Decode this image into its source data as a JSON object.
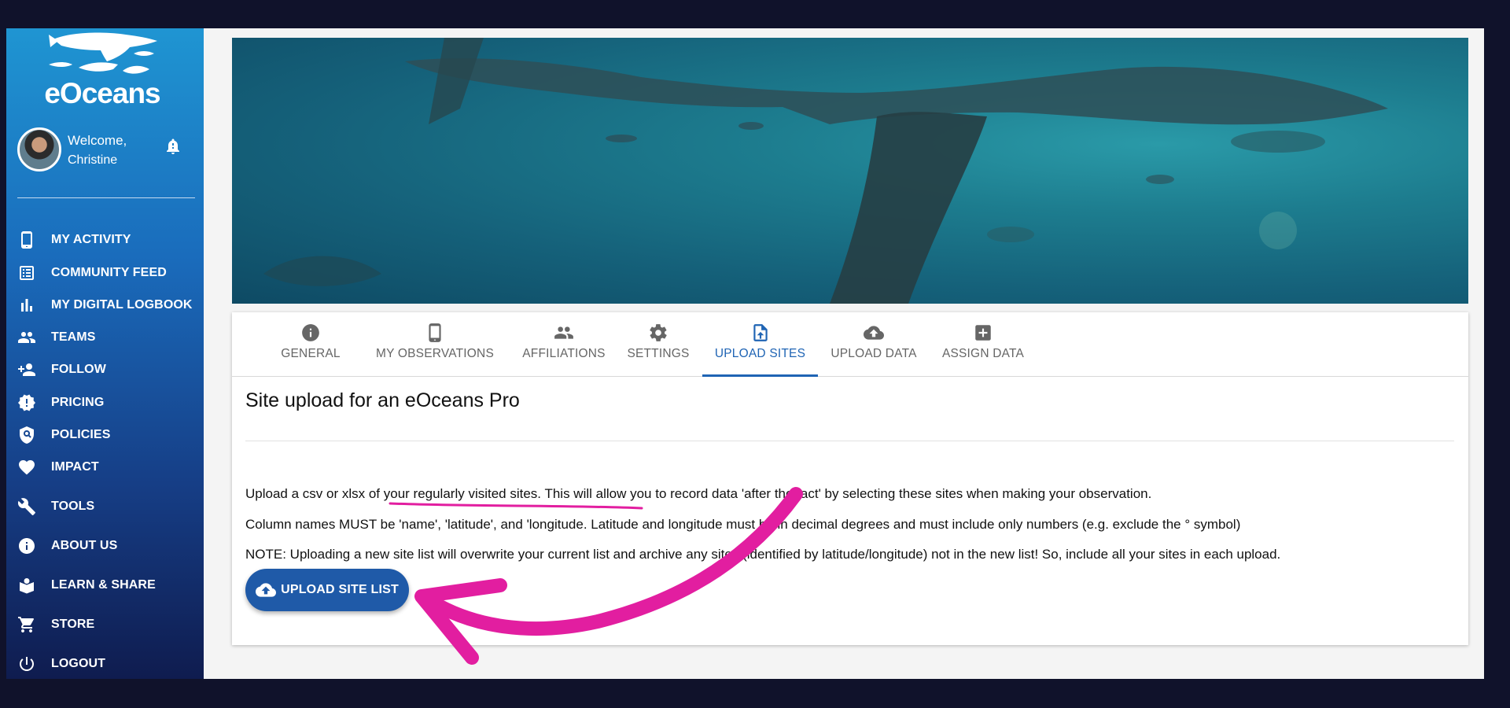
{
  "brand": {
    "name": "eOceans"
  },
  "user": {
    "welcome": "Welcome,",
    "name": "Christine"
  },
  "nav": [
    {
      "label": "MY ACTIVITY",
      "icon": "phone-icon"
    },
    {
      "label": "COMMUNITY FEED",
      "icon": "feed-icon"
    },
    {
      "label": "MY DIGITAL LOGBOOK",
      "icon": "bar-chart-icon"
    },
    {
      "label": "TEAMS",
      "icon": "people-icon"
    },
    {
      "label": "FOLLOW",
      "icon": "add-person-icon"
    },
    {
      "label": "PRICING",
      "icon": "badge-icon"
    },
    {
      "label": "POLICIES",
      "icon": "shield-icon"
    },
    {
      "label": "IMPACT",
      "icon": "heart-icon"
    },
    {
      "label": "TOOLS",
      "icon": "wrench-icon"
    },
    {
      "label": "ABOUT US",
      "icon": "info-icon"
    },
    {
      "label": "LEARN & SHARE",
      "icon": "book-icon"
    },
    {
      "label": "STORE",
      "icon": "cart-icon"
    },
    {
      "label": "LOGOUT",
      "icon": "power-icon"
    }
  ],
  "tabs": [
    {
      "label": "GENERAL",
      "icon": "info-icon"
    },
    {
      "label": "MY OBSERVATIONS",
      "icon": "phone-icon"
    },
    {
      "label": "AFFILIATIONS",
      "icon": "people-icon"
    },
    {
      "label": "SETTINGS",
      "icon": "gear-icon"
    },
    {
      "label": "UPLOAD SITES",
      "icon": "file-upload-icon",
      "active": true
    },
    {
      "label": "UPLOAD DATA",
      "icon": "cloud-upload-icon"
    },
    {
      "label": "ASSIGN DATA",
      "icon": "add-box-icon"
    }
  ],
  "content": {
    "title": "Site upload for an eOceans Pro",
    "p1": "Upload a csv or xlsx of your regularly visited sites. This will allow you to record data 'after the fact' by selecting these sites when making your observation.",
    "p2": "Column names MUST be 'name', 'latitude', and 'longitude. Latitude and longitude must be in decimal degrees and must include only numbers (e.g. exclude the ° symbol)",
    "p3": "NOTE: Uploading a new site list will overwrite your current list and archive any sites (identified by latitude/longitude) not in the new list! So, include all your sites in each upload.",
    "button": "UPLOAD SITE LIST"
  },
  "colors": {
    "accent": "#1f64b4",
    "button": "#1f5aa8",
    "annotation": "#e21ea0",
    "background": "#10122b"
  }
}
